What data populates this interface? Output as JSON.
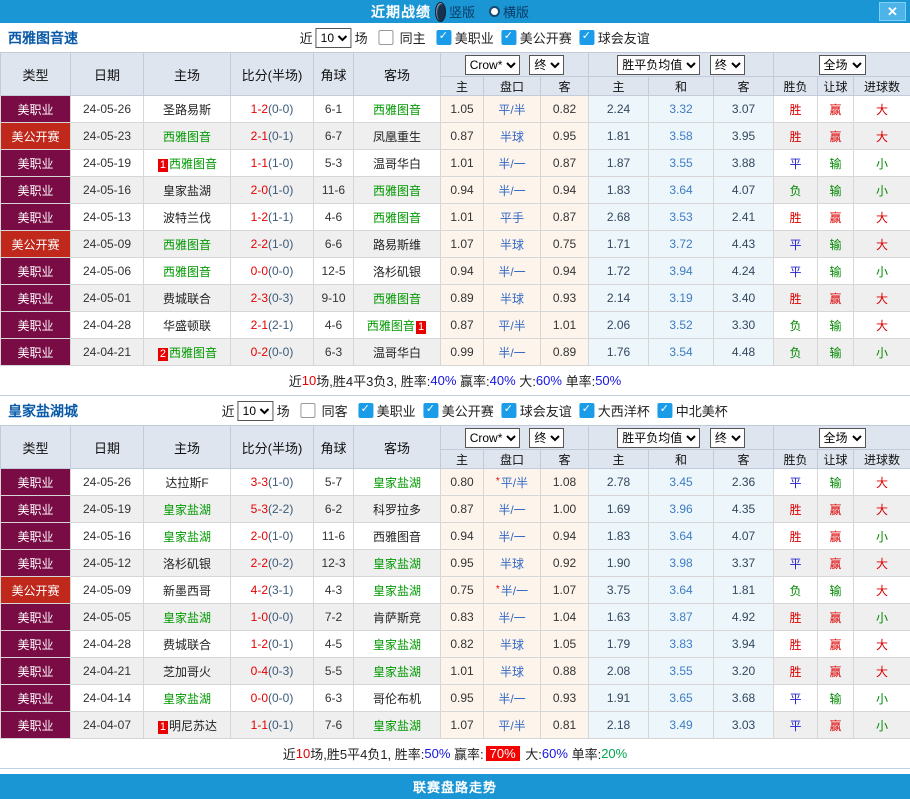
{
  "titlebar": {
    "title": "近期战绩",
    "vertical_label": "竖版",
    "horizontal_label": "横版",
    "close": "✕"
  },
  "colors": {
    "accent_blue": "#1b96d5",
    "league_maroon": "#7a0c45",
    "cup_red": "#c0281c",
    "team_green": "#009900",
    "score_red": "#e60000",
    "stripe_grey": "#efefef",
    "odds_bg": "#fdf5ec",
    "avg_bg": "#ecf6fb",
    "win_red": "#dd0000",
    "draw_blue": "#2222cc",
    "lose_green": "#008800"
  },
  "table_header": {
    "type": "类型",
    "date": "日期",
    "home": "主场",
    "score": "比分(半场)",
    "corner": "角球",
    "away": "客场",
    "crow": "Crow*",
    "final": "终",
    "odds_home": "主",
    "odds_hdp": "盘口",
    "odds_away": "客",
    "avg": "胜平负均值",
    "avg_home": "主",
    "avg_draw": "和",
    "avg_away": "客",
    "full": "全场",
    "wl": "胜负",
    "hcp": "让球",
    "goals": "进球数"
  },
  "footer": {
    "label": "联赛盘路走势"
  },
  "sections": [
    {
      "team": "西雅图音速",
      "filters": {
        "near": "近",
        "count": "10",
        "games": "场",
        "same": "同主",
        "same_checked": false,
        "leagues": [
          "美职业",
          "美公开赛",
          "球会友谊"
        ]
      },
      "summary": [
        [
          "近",
          ""
        ],
        [
          "10",
          "rd"
        ],
        [
          "场,胜4平3负3, 胜率:",
          ""
        ],
        [
          "40%",
          "bl"
        ],
        [
          " 赢率:",
          ""
        ],
        [
          "40%",
          "bl"
        ],
        [
          " 大:",
          ""
        ],
        [
          "60%",
          "bl"
        ],
        [
          " 单率:",
          ""
        ],
        [
          "50%",
          "bl"
        ]
      ],
      "rows": [
        {
          "t": "美职业",
          "tc": "m",
          "d": "24-05-26",
          "hn": "圣路易斯",
          "hg": false,
          "hb": "",
          "hbs": "",
          "s": "1-2",
          "sh": "(0-0)",
          "cr": "6-1",
          "an": "西雅图音",
          "ag": true,
          "ab": "",
          "abs": "",
          "o1": "1.05",
          "hd": "平/半",
          "st": false,
          "o2": "0.82",
          "v1": "2.24",
          "v2": "3.32",
          "v3": "3.07",
          "r1": "胜",
          "c1": "r",
          "r2": "赢",
          "c2": "r",
          "r3": "大",
          "c3": "r"
        },
        {
          "t": "美公开赛",
          "tc": "c",
          "d": "24-05-23",
          "hn": "西雅图音",
          "hg": true,
          "hb": "",
          "hbs": "",
          "s": "2-1",
          "sh": "(0-1)",
          "cr": "6-7",
          "an": "凤凰重生",
          "ag": false,
          "ab": "",
          "abs": "",
          "o1": "0.87",
          "hd": "半球",
          "st": false,
          "o2": "0.95",
          "v1": "1.81",
          "v2": "3.58",
          "v3": "3.95",
          "r1": "胜",
          "c1": "r",
          "r2": "赢",
          "c2": "r",
          "r3": "大",
          "c3": "r"
        },
        {
          "t": "美职业",
          "tc": "m",
          "d": "24-05-19",
          "hn": "西雅图音",
          "hg": true,
          "hb": "1",
          "hbs": "l",
          "s": "1-1",
          "sh": "(1-0)",
          "cr": "5-3",
          "an": "温哥华白",
          "ag": false,
          "ab": "",
          "abs": "",
          "o1": "1.01",
          "hd": "半/一",
          "st": false,
          "o2": "0.87",
          "v1": "1.87",
          "v2": "3.55",
          "v3": "3.88",
          "r1": "平",
          "c1": "b",
          "r2": "输",
          "c2": "g",
          "r3": "小",
          "c3": "g"
        },
        {
          "t": "美职业",
          "tc": "m",
          "d": "24-05-16",
          "hn": "皇家盐湖",
          "hg": false,
          "hb": "",
          "hbs": "",
          "s": "2-0",
          "sh": "(1-0)",
          "cr": "11-6",
          "an": "西雅图音",
          "ag": true,
          "ab": "",
          "abs": "",
          "o1": "0.94",
          "hd": "半/一",
          "st": false,
          "o2": "0.94",
          "v1": "1.83",
          "v2": "3.64",
          "v3": "4.07",
          "r1": "负",
          "c1": "g",
          "r2": "输",
          "c2": "g",
          "r3": "小",
          "c3": "g"
        },
        {
          "t": "美职业",
          "tc": "m",
          "d": "24-05-13",
          "hn": "波特兰伐",
          "hg": false,
          "hb": "",
          "hbs": "",
          "s": "1-2",
          "sh": "(1-1)",
          "cr": "4-6",
          "an": "西雅图音",
          "ag": true,
          "ab": "",
          "abs": "",
          "o1": "1.01",
          "hd": "平手",
          "st": false,
          "o2": "0.87",
          "v1": "2.68",
          "v2": "3.53",
          "v3": "2.41",
          "r1": "胜",
          "c1": "r",
          "r2": "赢",
          "c2": "r",
          "r3": "大",
          "c3": "r"
        },
        {
          "t": "美公开赛",
          "tc": "c",
          "d": "24-05-09",
          "hn": "西雅图音",
          "hg": true,
          "hb": "",
          "hbs": "",
          "s": "2-2",
          "sh": "(1-0)",
          "cr": "6-6",
          "an": "路易斯维",
          "ag": false,
          "ab": "",
          "abs": "",
          "o1": "1.07",
          "hd": "半球",
          "st": false,
          "o2": "0.75",
          "v1": "1.71",
          "v2": "3.72",
          "v3": "4.43",
          "r1": "平",
          "c1": "b",
          "r2": "输",
          "c2": "g",
          "r3": "大",
          "c3": "r"
        },
        {
          "t": "美职业",
          "tc": "m",
          "d": "24-05-06",
          "hn": "西雅图音",
          "hg": true,
          "hb": "",
          "hbs": "",
          "s": "0-0",
          "sh": "(0-0)",
          "cr": "12-5",
          "an": "洛杉矶银",
          "ag": false,
          "ab": "",
          "abs": "",
          "o1": "0.94",
          "hd": "半/一",
          "st": false,
          "o2": "0.94",
          "v1": "1.72",
          "v2": "3.94",
          "v3": "4.24",
          "r1": "平",
          "c1": "b",
          "r2": "输",
          "c2": "g",
          "r3": "小",
          "c3": "g"
        },
        {
          "t": "美职业",
          "tc": "m",
          "d": "24-05-01",
          "hn": "费城联合",
          "hg": false,
          "hb": "",
          "hbs": "",
          "s": "2-3",
          "sh": "(0-3)",
          "cr": "9-10",
          "an": "西雅图音",
          "ag": true,
          "ab": "",
          "abs": "",
          "o1": "0.89",
          "hd": "半球",
          "st": false,
          "o2": "0.93",
          "v1": "2.14",
          "v2": "3.19",
          "v3": "3.40",
          "r1": "胜",
          "c1": "r",
          "r2": "赢",
          "c2": "r",
          "r3": "大",
          "c3": "r"
        },
        {
          "t": "美职业",
          "tc": "m",
          "d": "24-04-28",
          "hn": "华盛顿联",
          "hg": false,
          "hb": "",
          "hbs": "",
          "s": "2-1",
          "sh": "(2-1)",
          "cr": "4-6",
          "an": "西雅图音",
          "ag": true,
          "ab": "1",
          "abs": "r",
          "o1": "0.87",
          "hd": "平/半",
          "st": false,
          "o2": "1.01",
          "v1": "2.06",
          "v2": "3.52",
          "v3": "3.30",
          "r1": "负",
          "c1": "g",
          "r2": "输",
          "c2": "g",
          "r3": "大",
          "c3": "r"
        },
        {
          "t": "美职业",
          "tc": "m",
          "d": "24-04-21",
          "hn": "西雅图音",
          "hg": true,
          "hb": "2",
          "hbs": "l",
          "s": "0-2",
          "sh": "(0-0)",
          "cr": "6-3",
          "an": "温哥华白",
          "ag": false,
          "ab": "",
          "abs": "",
          "o1": "0.99",
          "hd": "半/一",
          "st": false,
          "o2": "0.89",
          "v1": "1.76",
          "v2": "3.54",
          "v3": "4.48",
          "r1": "负",
          "c1": "g",
          "r2": "输",
          "c2": "g",
          "r3": "小",
          "c3": "g"
        }
      ]
    },
    {
      "team": "皇家盐湖城",
      "filters": {
        "near": "近",
        "count": "10",
        "games": "场",
        "same": "同客",
        "same_checked": false,
        "leagues": [
          "美职业",
          "美公开赛",
          "球会友谊",
          "大西洋杯",
          "中北美杯"
        ]
      },
      "summary": [
        [
          "近",
          ""
        ],
        [
          "10",
          "rd"
        ],
        [
          "场,胜5平4负1, 胜率:",
          ""
        ],
        [
          "50%",
          "bl"
        ],
        [
          " 赢率:",
          ""
        ],
        [
          "70%",
          "hl"
        ],
        [
          " 大:",
          ""
        ],
        [
          "60%",
          "bl"
        ],
        [
          " 单率:",
          ""
        ],
        [
          "20%",
          "gn"
        ]
      ],
      "rows": [
        {
          "t": "美职业",
          "tc": "m",
          "d": "24-05-26",
          "hn": "达拉斯F",
          "hg": false,
          "hb": "",
          "hbs": "",
          "s": "3-3",
          "sh": "(1-0)",
          "cr": "5-7",
          "an": "皇家盐湖",
          "ag": true,
          "ab": "",
          "abs": "",
          "o1": "0.80",
          "hd": "平/半",
          "st": true,
          "o2": "1.08",
          "v1": "2.78",
          "v2": "3.45",
          "v3": "2.36",
          "r1": "平",
          "c1": "b",
          "r2": "输",
          "c2": "g",
          "r3": "大",
          "c3": "r"
        },
        {
          "t": "美职业",
          "tc": "m",
          "d": "24-05-19",
          "hn": "皇家盐湖",
          "hg": true,
          "hb": "",
          "hbs": "",
          "s": "5-3",
          "sh": "(2-2)",
          "cr": "6-2",
          "an": "科罗拉多",
          "ag": false,
          "ab": "",
          "abs": "",
          "o1": "0.87",
          "hd": "半/一",
          "st": false,
          "o2": "1.00",
          "v1": "1.69",
          "v2": "3.96",
          "v3": "4.35",
          "r1": "胜",
          "c1": "r",
          "r2": "赢",
          "c2": "r",
          "r3": "大",
          "c3": "r"
        },
        {
          "t": "美职业",
          "tc": "m",
          "d": "24-05-16",
          "hn": "皇家盐湖",
          "hg": true,
          "hb": "",
          "hbs": "",
          "s": "2-0",
          "sh": "(1-0)",
          "cr": "11-6",
          "an": "西雅图音",
          "ag": false,
          "ab": "",
          "abs": "",
          "o1": "0.94",
          "hd": "半/一",
          "st": false,
          "o2": "0.94",
          "v1": "1.83",
          "v2": "3.64",
          "v3": "4.07",
          "r1": "胜",
          "c1": "r",
          "r2": "赢",
          "c2": "r",
          "r3": "小",
          "c3": "g"
        },
        {
          "t": "美职业",
          "tc": "m",
          "d": "24-05-12",
          "hn": "洛杉矶银",
          "hg": false,
          "hb": "",
          "hbs": "",
          "s": "2-2",
          "sh": "(0-2)",
          "cr": "12-3",
          "an": "皇家盐湖",
          "ag": true,
          "ab": "",
          "abs": "",
          "o1": "0.95",
          "hd": "半球",
          "st": false,
          "o2": "0.92",
          "v1": "1.90",
          "v2": "3.98",
          "v3": "3.37",
          "r1": "平",
          "c1": "b",
          "r2": "赢",
          "c2": "r",
          "r3": "大",
          "c3": "r"
        },
        {
          "t": "美公开赛",
          "tc": "c",
          "d": "24-05-09",
          "hn": "新墨西哥",
          "hg": false,
          "hb": "",
          "hbs": "",
          "s": "4-2",
          "sh": "(3-1)",
          "cr": "4-3",
          "an": "皇家盐湖",
          "ag": true,
          "ab": "",
          "abs": "",
          "o1": "0.75",
          "hd": "半/一",
          "st": true,
          "o2": "1.07",
          "v1": "3.75",
          "v2": "3.64",
          "v3": "1.81",
          "r1": "负",
          "c1": "g",
          "r2": "输",
          "c2": "g",
          "r3": "大",
          "c3": "r"
        },
        {
          "t": "美职业",
          "tc": "m",
          "d": "24-05-05",
          "hn": "皇家盐湖",
          "hg": true,
          "hb": "",
          "hbs": "",
          "s": "1-0",
          "sh": "(0-0)",
          "cr": "7-2",
          "an": "肯萨斯竞",
          "ag": false,
          "ab": "",
          "abs": "",
          "o1": "0.83",
          "hd": "半/一",
          "st": false,
          "o2": "1.04",
          "v1": "1.63",
          "v2": "3.87",
          "v3": "4.92",
          "r1": "胜",
          "c1": "r",
          "r2": "赢",
          "c2": "r",
          "r3": "小",
          "c3": "g"
        },
        {
          "t": "美职业",
          "tc": "m",
          "d": "24-04-28",
          "hn": "费城联合",
          "hg": false,
          "hb": "",
          "hbs": "",
          "s": "1-2",
          "sh": "(0-1)",
          "cr": "4-5",
          "an": "皇家盐湖",
          "ag": true,
          "ab": "",
          "abs": "",
          "o1": "0.82",
          "hd": "半球",
          "st": false,
          "o2": "1.05",
          "v1": "1.79",
          "v2": "3.83",
          "v3": "3.94",
          "r1": "胜",
          "c1": "r",
          "r2": "赢",
          "c2": "r",
          "r3": "大",
          "c3": "r"
        },
        {
          "t": "美职业",
          "tc": "m",
          "d": "24-04-21",
          "hn": "芝加哥火",
          "hg": false,
          "hb": "",
          "hbs": "",
          "s": "0-4",
          "sh": "(0-3)",
          "cr": "5-5",
          "an": "皇家盐湖",
          "ag": true,
          "ab": "",
          "abs": "",
          "o1": "1.01",
          "hd": "半球",
          "st": false,
          "o2": "0.88",
          "v1": "2.08",
          "v2": "3.55",
          "v3": "3.20",
          "r1": "胜",
          "c1": "r",
          "r2": "赢",
          "c2": "r",
          "r3": "大",
          "c3": "r"
        },
        {
          "t": "美职业",
          "tc": "m",
          "d": "24-04-14",
          "hn": "皇家盐湖",
          "hg": true,
          "hb": "",
          "hbs": "",
          "s": "0-0",
          "sh": "(0-0)",
          "cr": "6-3",
          "an": "哥伦布机",
          "ag": false,
          "ab": "",
          "abs": "",
          "o1": "0.95",
          "hd": "半/一",
          "st": false,
          "o2": "0.93",
          "v1": "1.91",
          "v2": "3.65",
          "v3": "3.68",
          "r1": "平",
          "c1": "b",
          "r2": "输",
          "c2": "g",
          "r3": "小",
          "c3": "g"
        },
        {
          "t": "美职业",
          "tc": "m",
          "d": "24-04-07",
          "hn": "明尼苏达",
          "hg": false,
          "hb": "1",
          "hbs": "l",
          "s": "1-1",
          "sh": "(0-1)",
          "cr": "7-6",
          "an": "皇家盐湖",
          "ag": true,
          "ab": "",
          "abs": "",
          "o1": "1.07",
          "hd": "平/半",
          "st": false,
          "o2": "0.81",
          "v1": "2.18",
          "v2": "3.49",
          "v3": "3.03",
          "r1": "平",
          "c1": "b",
          "r2": "赢",
          "c2": "r",
          "r3": "小",
          "c3": "g"
        }
      ]
    }
  ]
}
